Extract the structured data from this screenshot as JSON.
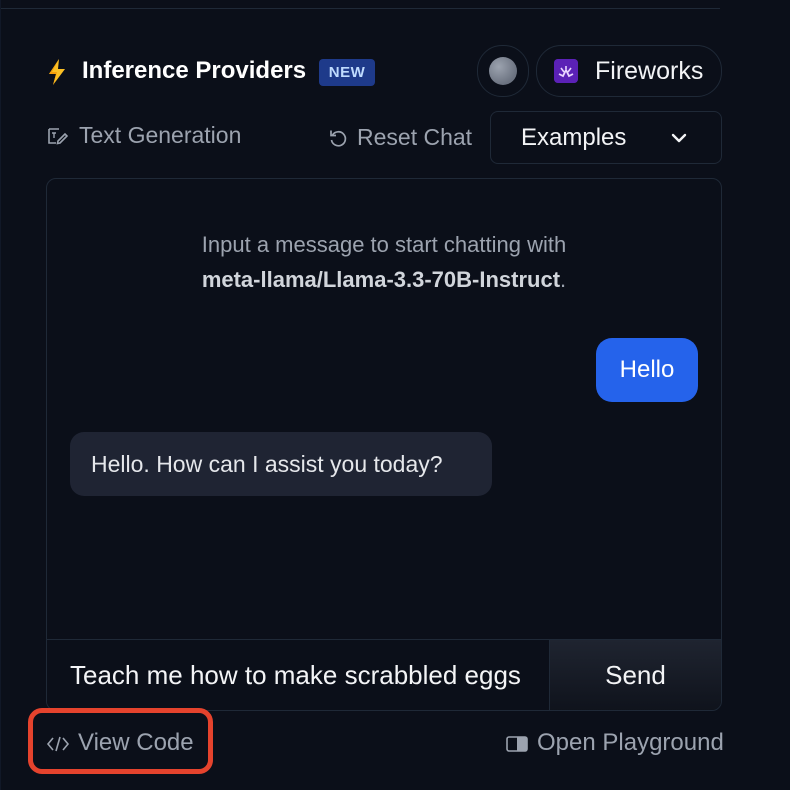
{
  "header": {
    "title": "Inference Providers",
    "badge": "NEW",
    "provider_name": "Fireworks"
  },
  "toolbar": {
    "task": "Text Generation",
    "reset_label": "Reset Chat",
    "examples_label": "Examples"
  },
  "chat": {
    "intro_prefix": "Input a message to start chatting with",
    "model": "meta-llama/Llama-3.3-70B-Instruct",
    "intro_suffix": ".",
    "messages": [
      {
        "role": "user",
        "text": "Hello"
      },
      {
        "role": "assistant",
        "text": "Hello. How can I assist you today?"
      }
    ],
    "input_value": "Teach me how to make scrabbled eggs",
    "send_label": "Send"
  },
  "footer": {
    "view_code_label": "View Code",
    "playground_label": "Open Playground"
  },
  "colors": {
    "background": "#0b0f19",
    "accent": "#2563eb",
    "highlight": "#e5432d",
    "provider_brand": "#5b21b6"
  },
  "icons": [
    "bolt-icon",
    "fireworks-icon",
    "text-generation-icon",
    "reset-icon",
    "chevron-down-icon",
    "code-icon",
    "panel-icon"
  ]
}
